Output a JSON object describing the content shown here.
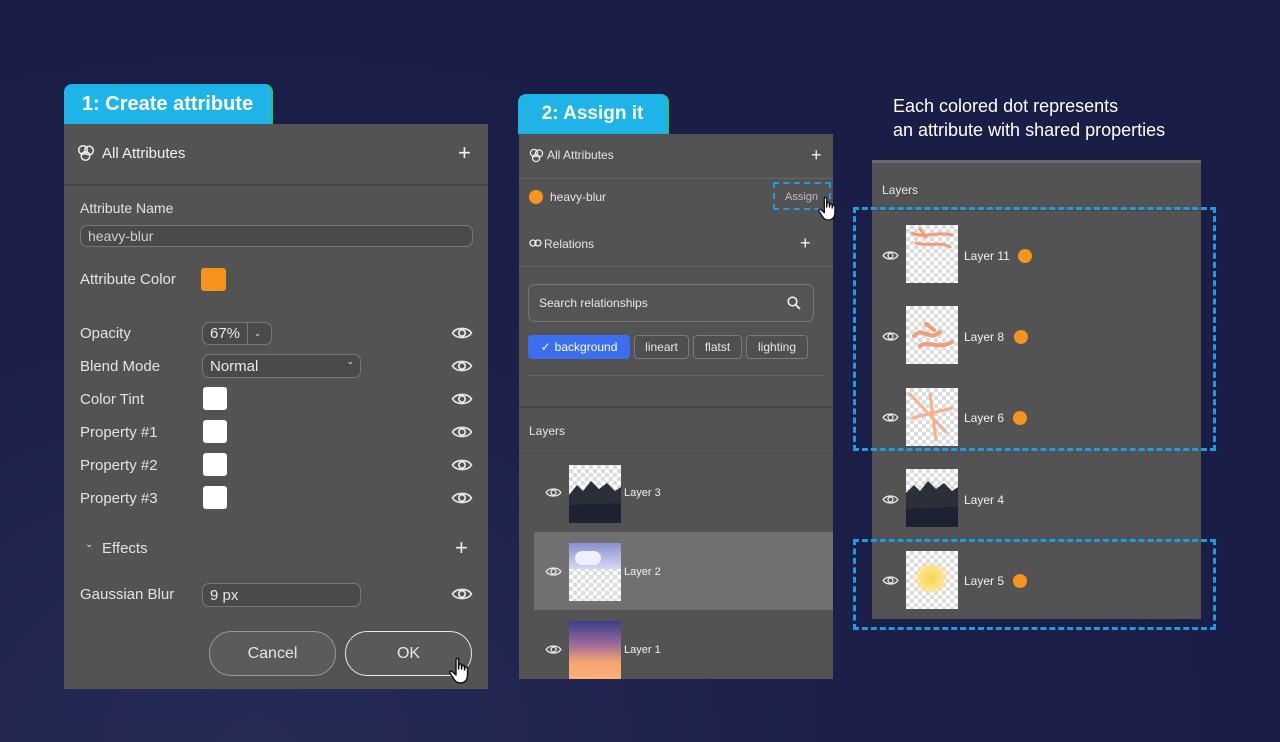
{
  "annotation": {
    "line1": "Each colored dot represents",
    "line2": "an attribute with shared properties"
  },
  "step1": {
    "tab_label": "1: Create attribute",
    "header": "All Attributes",
    "attr_name_label": "Attribute Name",
    "attr_name_value": "heavy-blur",
    "attr_color_label": "Attribute Color",
    "attr_color": "#f7941d",
    "properties": [
      {
        "label": "Opacity",
        "value": "67%"
      },
      {
        "label": "Blend Mode",
        "value": "Normal"
      },
      {
        "label": "Color Tint"
      },
      {
        "label": "Property #1"
      },
      {
        "label": "Property #2"
      },
      {
        "label": "Property #3"
      }
    ],
    "effects_label": "Effects",
    "gaussian_label": "Gaussian Blur",
    "gaussian_value": "9 px",
    "cancel_label": "Cancel",
    "ok_label": "OK"
  },
  "step2": {
    "tab_label": "2: Assign it",
    "header": "All Attributes",
    "attribute_name": "heavy-blur",
    "assign_label": "Assign",
    "relations_label": "Relations",
    "search_placeholder": "Search relationships",
    "chips": [
      "background",
      "lineart",
      "flatst",
      "lighting"
    ],
    "layers_label": "Layers",
    "layers": [
      "Layer 3",
      "Layer 2",
      "Layer 1"
    ]
  },
  "step3": {
    "layers_label": "Layers",
    "layers": [
      "Layer 11",
      "Layer 8",
      "Layer 6",
      "Layer 4",
      "Layer 5"
    ]
  },
  "colors": {
    "accent_tab": "#1fb4e8",
    "attribute_dot": "#f7941d",
    "chip_active": "#3b6ff0",
    "dashed_highlight": "#1f9be0"
  }
}
